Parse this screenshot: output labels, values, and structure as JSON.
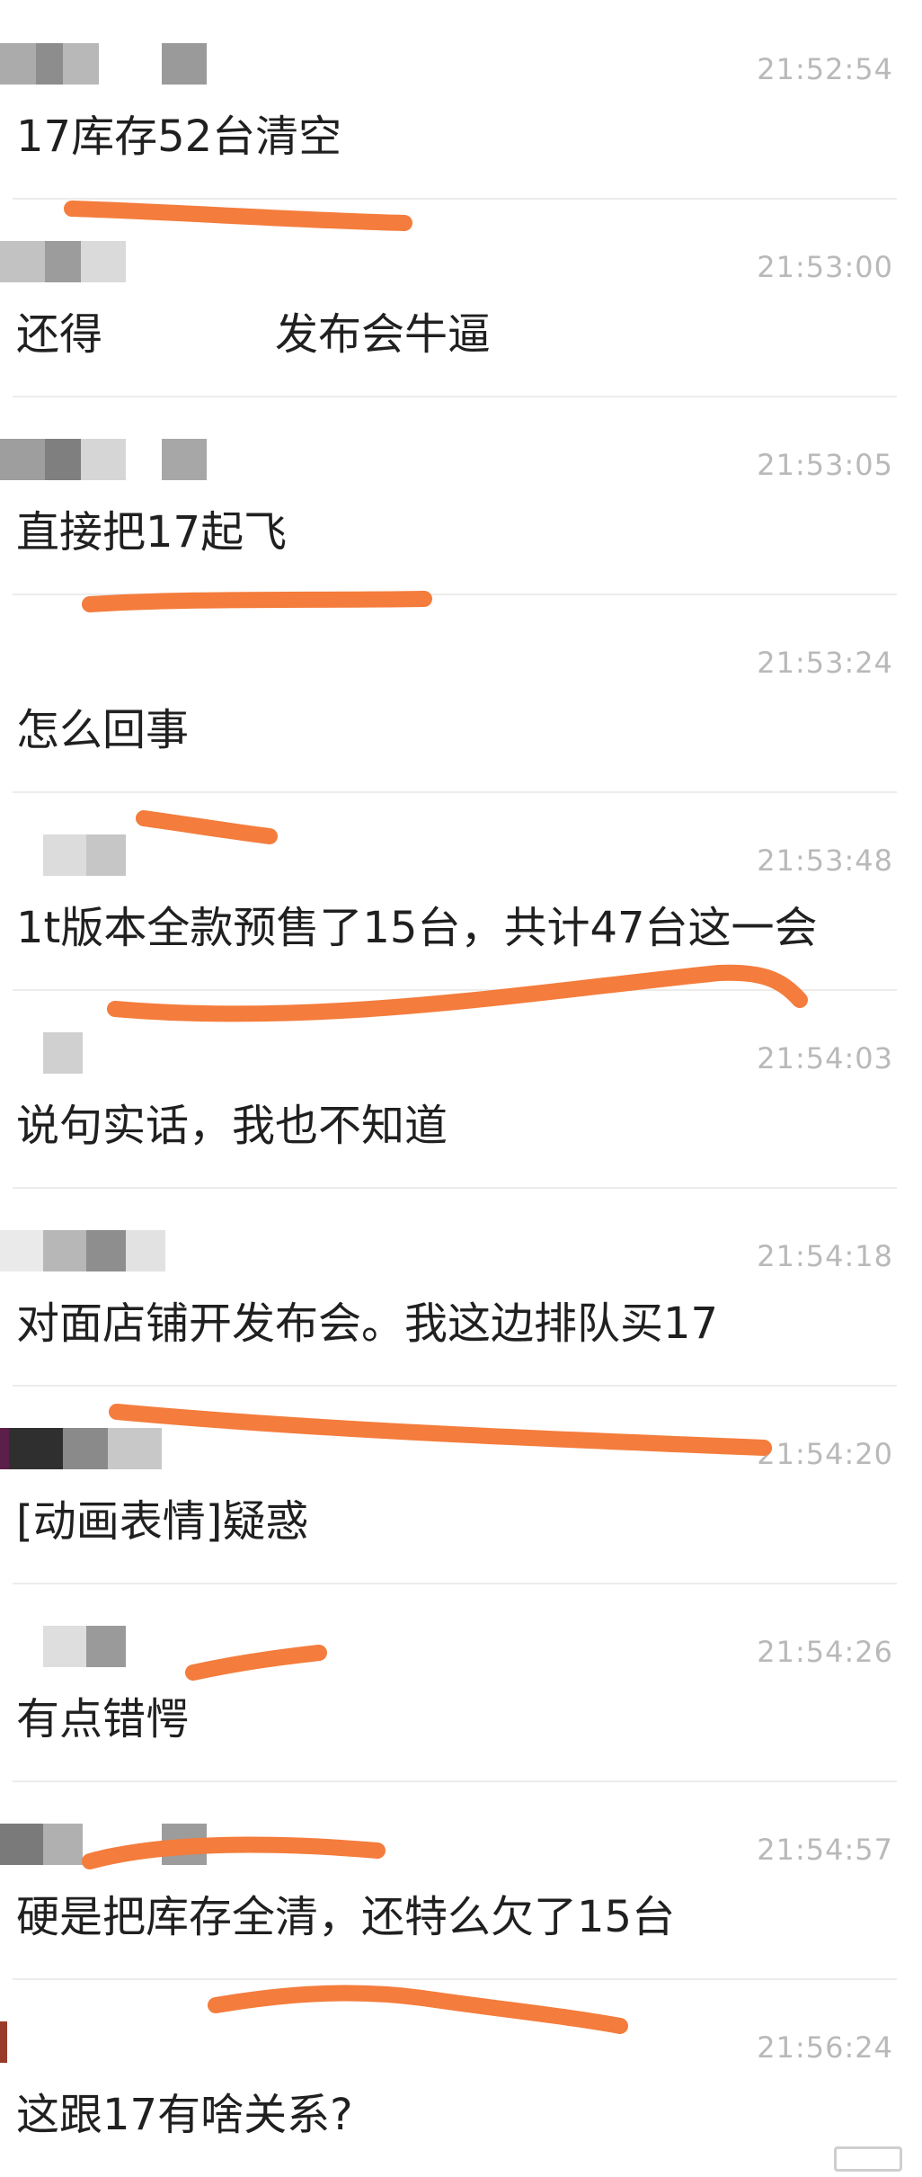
{
  "messages": [
    {
      "time": "21:52:54",
      "text": "17库存52台清空"
    },
    {
      "time": "21:53:00",
      "text": "还得　　　　发布会牛逼"
    },
    {
      "time": "21:53:05",
      "text": "直接把17起飞"
    },
    {
      "time": "21:53:24",
      "text": "怎么回事"
    },
    {
      "time": "21:53:48",
      "text": "1t版本全款预售了15台，共计47台这一会"
    },
    {
      "time": "21:54:03",
      "text": "说句实话，我也不知道"
    },
    {
      "time": "21:54:18",
      "text": "对面店铺开发布会。我这边排队买17"
    },
    {
      "time": "21:54:20",
      "text": "[动画表情]疑惑"
    },
    {
      "time": "21:54:26",
      "text": "有点错愕"
    },
    {
      "time": "21:54:57",
      "text": "硬是把库存全清，还特么欠了15台"
    },
    {
      "time": "21:56:24",
      "text": "这跟17有啥关系?"
    }
  ],
  "colors": {
    "annotation_stroke": "#f47c3c",
    "time_text": "#b9b9b9",
    "message_text": "#202020",
    "divider": "#ececec"
  }
}
